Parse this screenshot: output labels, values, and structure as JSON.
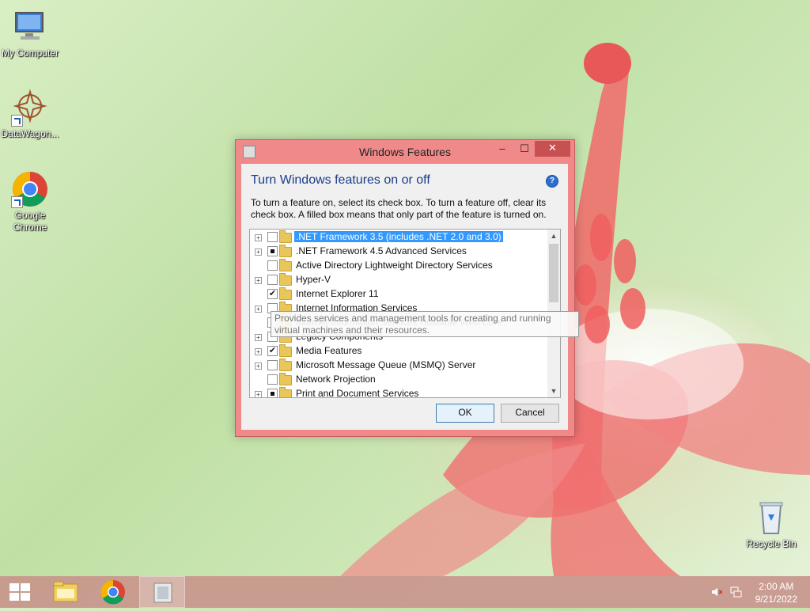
{
  "desktop": {
    "icons": [
      {
        "label": "My Computer"
      },
      {
        "label": "DataWagon..."
      },
      {
        "label": "Google Chrome"
      },
      {
        "label": "Recycle Bin"
      }
    ]
  },
  "window": {
    "title": "Windows Features",
    "buttons": {
      "minimize": "–",
      "maximize": "☐",
      "close": "✕"
    },
    "heading": "Turn Windows features on or off",
    "help": "?",
    "description": "To turn a feature on, select its check box. To turn a feature off, clear its check box. A filled box means that only part of the feature is turned on.",
    "features": [
      {
        "label": ".NET Framework 3.5 (includes .NET 2.0 and 3.0)",
        "expandable": true,
        "state": "unchecked",
        "selected": true
      },
      {
        "label": ".NET Framework 4.5 Advanced Services",
        "expandable": true,
        "state": "partial",
        "selected": false
      },
      {
        "label": "Active Directory Lightweight Directory Services",
        "expandable": false,
        "state": "unchecked",
        "selected": false
      },
      {
        "label": "Hyper-V",
        "expandable": true,
        "state": "unchecked",
        "selected": false
      },
      {
        "label": "Internet Explorer 11",
        "expandable": false,
        "state": "checked",
        "selected": false
      },
      {
        "label": "Internet Information Services",
        "expandable": true,
        "state": "unchecked",
        "selected": false
      },
      {
        "label": "Internet Information Services Hostable Web Core",
        "expandable": false,
        "state": "unchecked",
        "selected": false
      },
      {
        "label": "Legacy Components",
        "expandable": true,
        "state": "unchecked",
        "selected": false
      },
      {
        "label": "Media Features",
        "expandable": true,
        "state": "checked",
        "selected": false
      },
      {
        "label": "Microsoft Message Queue (MSMQ) Server",
        "expandable": true,
        "state": "unchecked",
        "selected": false
      },
      {
        "label": "Network Projection",
        "expandable": false,
        "state": "unchecked",
        "selected": false
      },
      {
        "label": "Print and Document Services",
        "expandable": true,
        "state": "partial",
        "selected": false
      }
    ],
    "tooltip": "Provides services and management tools for creating and running virtual machines and their resources.",
    "ok_label": "OK",
    "cancel_label": "Cancel"
  },
  "taskbar": {
    "items": [
      "start-button",
      "file-explorer",
      "google-chrome",
      "windows-features"
    ],
    "time": "2:00 AM",
    "date": "9/21/2022"
  },
  "colors": {
    "window_frame": "#f08a8a",
    "close_button": "#c75050",
    "selection": "#3399ff",
    "heading": "#1a3c8c",
    "taskbar": "#c8968c"
  }
}
